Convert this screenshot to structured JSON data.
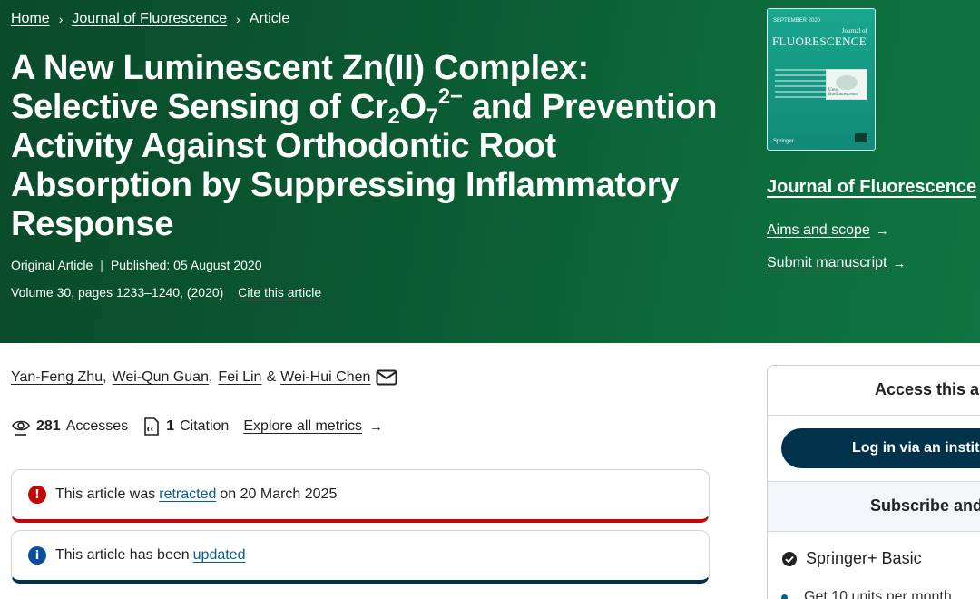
{
  "breadcrumb": {
    "home": "Home",
    "journal": "Journal of Fluorescence",
    "current": "Article",
    "separator": "›"
  },
  "article": {
    "title_line1": "A New Luminescent Zn(II) Complex:",
    "title_line2_a": "Selective Sensing of Cr",
    "title_line2_sub1": "2",
    "title_line2_b": "O",
    "title_line2_sub2": "7",
    "title_line2_sup": "2−",
    "title_line2_c": " and Prevention",
    "title_line3": "Activity Against Orthodontic Root",
    "title_line4": "Absorption by Suppressing Inflammatory",
    "title_line5": "Response",
    "type": "Original Article",
    "published": "Published: 05 August 2020",
    "volume": "Volume 30, pages 1233–1240, (2020)",
    "cite_label": "Cite this article"
  },
  "cover": {
    "top_text": "SEPTEMBER 2020",
    "jof_small": "Journal of",
    "name": "FLUORESCENCE",
    "image_caption": "Urea Biofluorescence",
    "publisher": "Springer"
  },
  "sidebar": {
    "journal_name": "Journal of Fluorescence",
    "aims_label": "Aims and scope",
    "submit_label": "Submit manuscript",
    "arrow": "→"
  },
  "authors": {
    "list": [
      "Yan-Feng Zhu",
      "Wei-Qun Guan",
      "Fei Lin",
      "Wei-Hui Chen"
    ],
    "comma": ",",
    "amp": "&"
  },
  "metrics": {
    "accesses_count": "281",
    "accesses_label": "Accesses",
    "citation_count": "1",
    "citation_label": "Citation",
    "explore_label": "Explore all metrics",
    "arrow": "→"
  },
  "notices": {
    "retracted": {
      "icon": "!",
      "before": "This article was",
      "link": "retracted",
      "after": "on 20 March 2025",
      "border_color": "#c40606"
    },
    "updated": {
      "icon": "i",
      "before": "This article has been",
      "link": "updated",
      "border_color": "#01324b"
    }
  },
  "access_panel": {
    "title": "Access this article",
    "login_label": "Log in via an institution",
    "subscribe_title": "Subscribe and save",
    "plan_name": "Springer+ Basic",
    "plan_detail": "Get 10 units per month"
  },
  "colors": {
    "header_green": "#0b5b33",
    "link_blue": "#025e8d",
    "button_navy": "#01324b",
    "retract_red": "#c40606"
  }
}
